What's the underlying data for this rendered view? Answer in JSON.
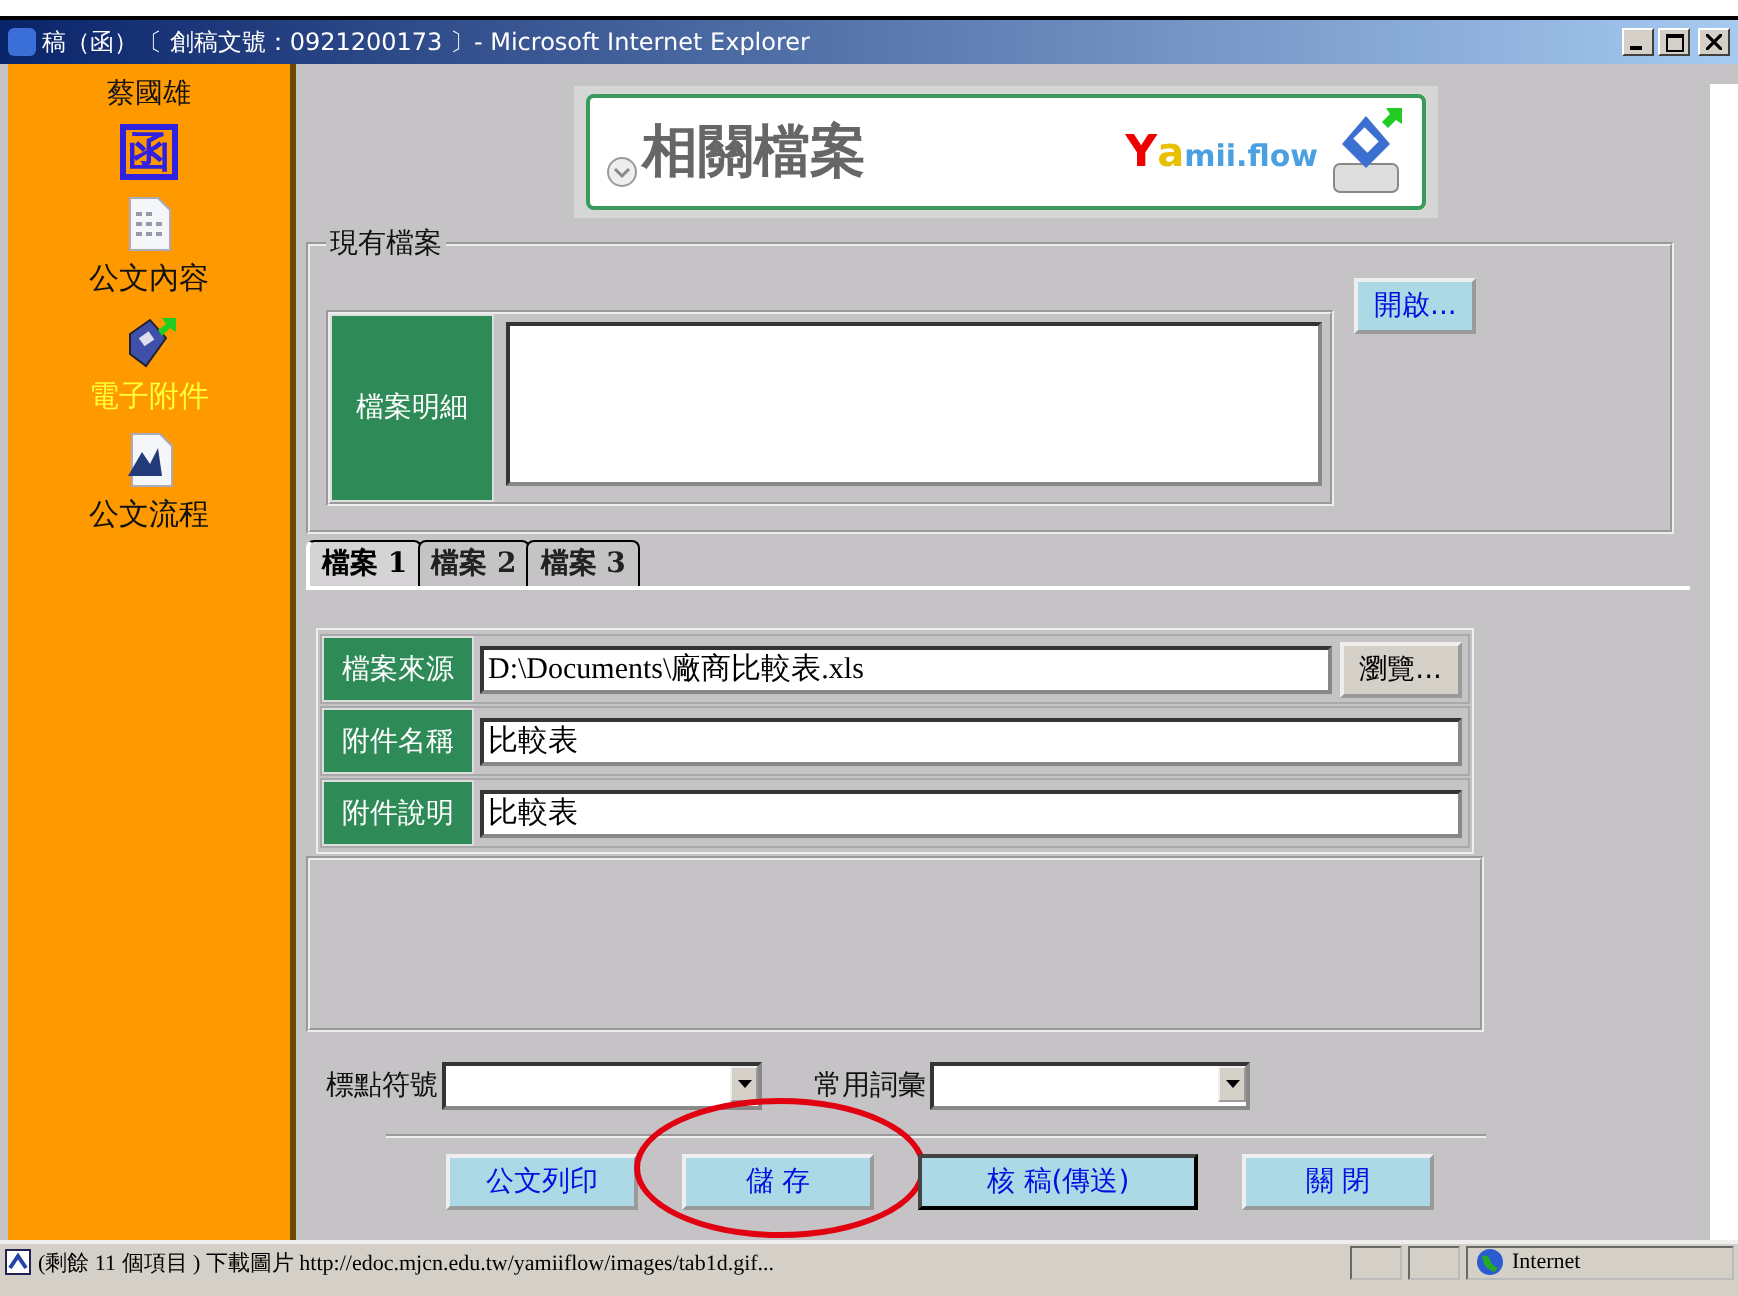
{
  "window": {
    "title": "稿（函）〔 創稿文號：0921200173 〕- Microsoft Internet Explorer"
  },
  "sidebar": {
    "user": "蔡國雄",
    "badge": "函",
    "items": [
      {
        "label": "公文內容",
        "kind": "document",
        "selected": false
      },
      {
        "label": "電子附件",
        "kind": "disk",
        "selected": true
      },
      {
        "label": "公文流程",
        "kind": "flow",
        "selected": false
      }
    ]
  },
  "banner": {
    "title": "相關檔案",
    "logo_y": "Y",
    "logo_a": "a",
    "logo_rest": "mii.flow"
  },
  "existing": {
    "legend": "現有檔案",
    "label": "檔案明細",
    "open_button": "開啟..."
  },
  "tabs": [
    {
      "label": "檔案 1",
      "selected": true
    },
    {
      "label": "檔案 2",
      "selected": false
    },
    {
      "label": "檔案 3",
      "selected": false
    }
  ],
  "fields": [
    {
      "label": "檔案來源",
      "value": "D:\\Documents\\廠商比較表.xls",
      "browse": "瀏覽..."
    },
    {
      "label": "附件名稱",
      "value": "比較表"
    },
    {
      "label": "附件說明",
      "value": "比較表"
    }
  ],
  "selects": [
    {
      "label": "標點符號"
    },
    {
      "label": "常用詞彙"
    }
  ],
  "buttons": [
    {
      "label": "公文列印",
      "highlighted": false
    },
    {
      "label": "儲 存",
      "highlighted": true
    },
    {
      "label": "核 稿(傳送)",
      "highlighted": false
    },
    {
      "label": "關 閉",
      "highlighted": false
    }
  ],
  "status_bar": {
    "text": "(剩餘 11 個項目 ) 下載圖片 http://edoc.mjcn.edu.tw/yamiiflow/images/tab1d.gif...",
    "zone": "Internet"
  }
}
